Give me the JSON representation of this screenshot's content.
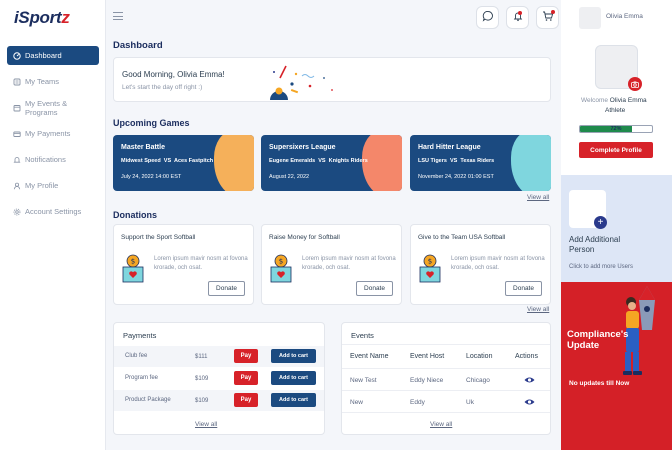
{
  "app": {
    "logo_main": "iSport",
    "logo_accent": "z"
  },
  "sidebar": {
    "items": [
      {
        "label": "Dashboard",
        "icon": "dashboard-icon",
        "active": true
      },
      {
        "label": "My Teams",
        "icon": "teams-icon"
      },
      {
        "label": "My Events & Programs",
        "icon": "calendar-icon"
      },
      {
        "label": "My Payments",
        "icon": "wallet-icon"
      },
      {
        "label": "Notifications",
        "icon": "bell-icon"
      },
      {
        "label": "My Profile",
        "icon": "user-icon"
      },
      {
        "label": "Account Settings",
        "icon": "gear-icon"
      }
    ]
  },
  "header": {
    "user_name": "Olivia Emma",
    "icons": [
      "chat-icon",
      "bell-icon",
      "cart-icon"
    ]
  },
  "main": {
    "title": "Dashboard",
    "greeting": "Good Morning, Olivia Emma!",
    "greeting_sub": "Let's start the day off right :)",
    "upcoming": {
      "title": "Upcoming Games",
      "view_all": "View all",
      "games": [
        {
          "league": "Master Battle",
          "team1": "Midwest Speed",
          "vs": "VS",
          "team2": "Aces Fastpitch",
          "date": "July 24, 2022 14:00 EST",
          "accent": "#f5b05a"
        },
        {
          "league": "Supersixers League",
          "team1": "Eugene Emeralds",
          "vs": "VS",
          "team2": "Knights Riders",
          "date": "August 22, 2022",
          "accent": "#f4876a"
        },
        {
          "league": "Hard Hitter League",
          "team1": "LSU Tigers",
          "vs": "VS",
          "team2": "Texas Riders",
          "date": "November 24, 2022 01:00 EST",
          "accent": "#7fd6de"
        }
      ]
    },
    "donations": {
      "title": "Donations",
      "view_all": "View all",
      "items": [
        {
          "title": "Support the Sport Softball",
          "desc": "Lorem ipsum mavir nosm at fovona krorade, och osat.",
          "button": "Donate"
        },
        {
          "title": "Raise Money for Softball",
          "desc": "Lorem ipsum mavir nosm at fovona krorade, och osat.",
          "button": "Donate"
        },
        {
          "title": "Give to the Team USA Softball",
          "desc": "Lorem ipsum mavir nosm at fovona krorade, och osat.",
          "button": "Donate"
        }
      ]
    },
    "payments": {
      "title": "Payments",
      "view_all": "View all",
      "pay_label": "Pay",
      "cart_label": "Add to cart",
      "rows": [
        {
          "name": "Club fee",
          "price": "$111"
        },
        {
          "name": "Program fee",
          "price": "$109"
        },
        {
          "name": "Product Package",
          "price": "$109"
        }
      ]
    },
    "events": {
      "title": "Events",
      "view_all": "View all",
      "columns": [
        "Event Name",
        "Event Host",
        "Location",
        "Actions"
      ],
      "rows": [
        {
          "name": "New Test",
          "host": "Eddy Niece",
          "location": "Chicago"
        },
        {
          "name": "New",
          "host": "Eddy",
          "location": "Uk"
        }
      ]
    }
  },
  "profile": {
    "welcome": "Welcome",
    "name": "Olivia Emma",
    "role": "Athlete",
    "progress": 72,
    "progress_label": "72%",
    "complete_button": "Complete Profile"
  },
  "add_person": {
    "title": "Add Additional Person",
    "sub": "Click to add more Users"
  },
  "compliance": {
    "title": "Compliance's Update",
    "status": "No updates till Now"
  },
  "colors": {
    "navy": "#1b4a80",
    "red": "#d72229",
    "green": "#1f8a4c"
  }
}
